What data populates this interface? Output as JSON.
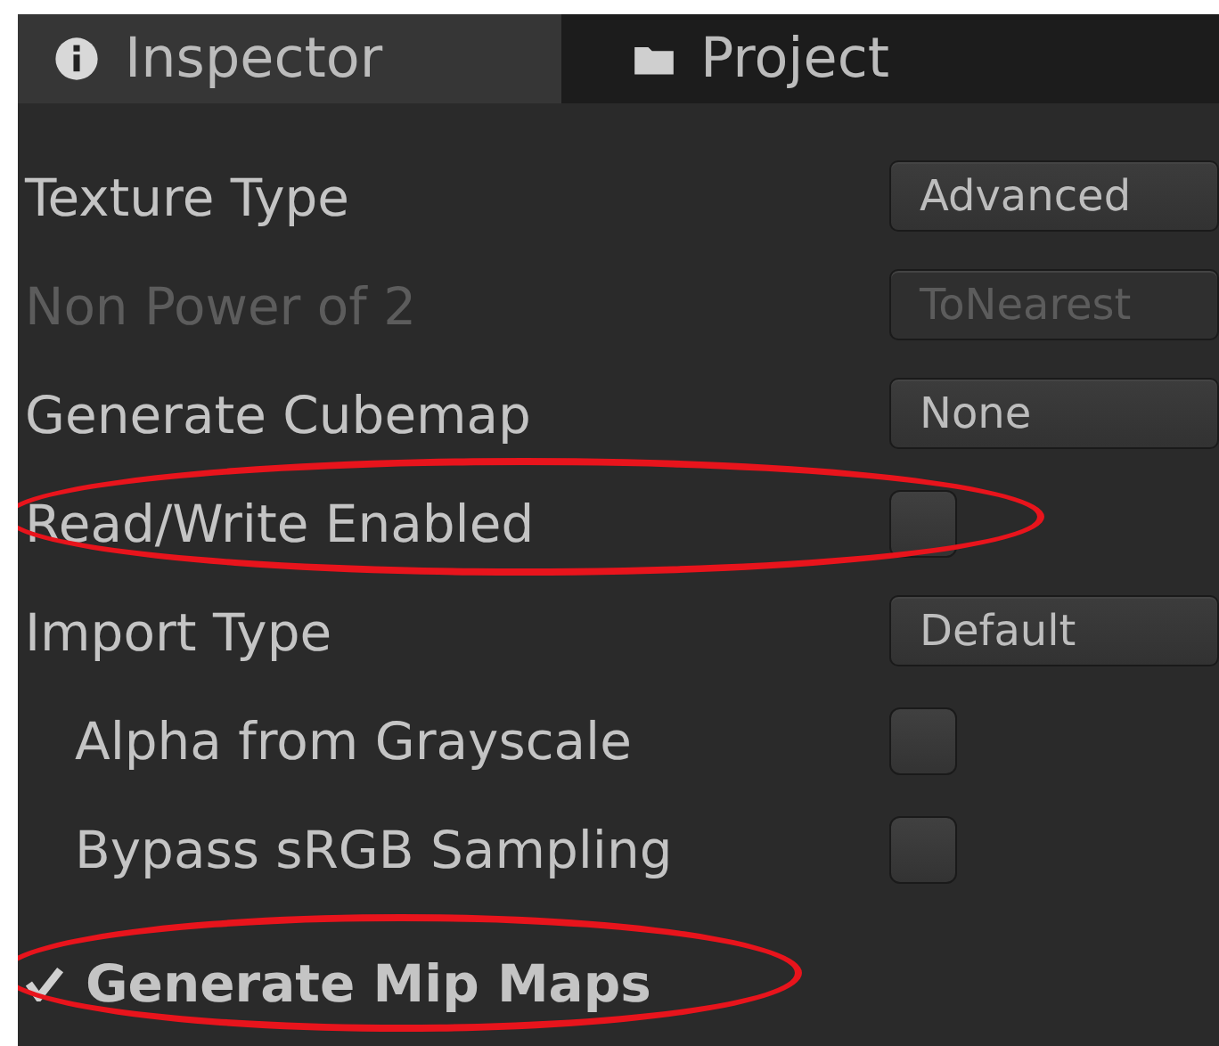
{
  "tabs": [
    {
      "label": "Inspector",
      "kind": "info",
      "selected": true
    },
    {
      "label": "Project",
      "kind": "folder",
      "selected": false
    }
  ],
  "rows": [
    {
      "kind": "dropdown",
      "label": "Texture Type",
      "value": "Advanced",
      "disabled": false
    },
    {
      "kind": "dropdown",
      "label": "Non Power of 2",
      "value": "ToNearest",
      "disabled": true
    },
    {
      "kind": "dropdown",
      "label": "Generate Cubemap",
      "value": "None",
      "disabled": false
    },
    {
      "kind": "checkbox",
      "label": "Read/Write Enabled",
      "checked": false,
      "highlighted": true
    },
    {
      "kind": "dropdown",
      "label": "Import Type",
      "value": "Default",
      "disabled": false,
      "children": [
        {
          "kind": "checkbox",
          "label": "Alpha from Grayscale",
          "checked": false
        },
        {
          "kind": "checkbox",
          "label": "Bypass sRGB Sampling",
          "checked": false
        }
      ]
    },
    {
      "kind": "toggle",
      "label": "Generate Mip Maps",
      "checked": true,
      "highlighted": true
    }
  ]
}
